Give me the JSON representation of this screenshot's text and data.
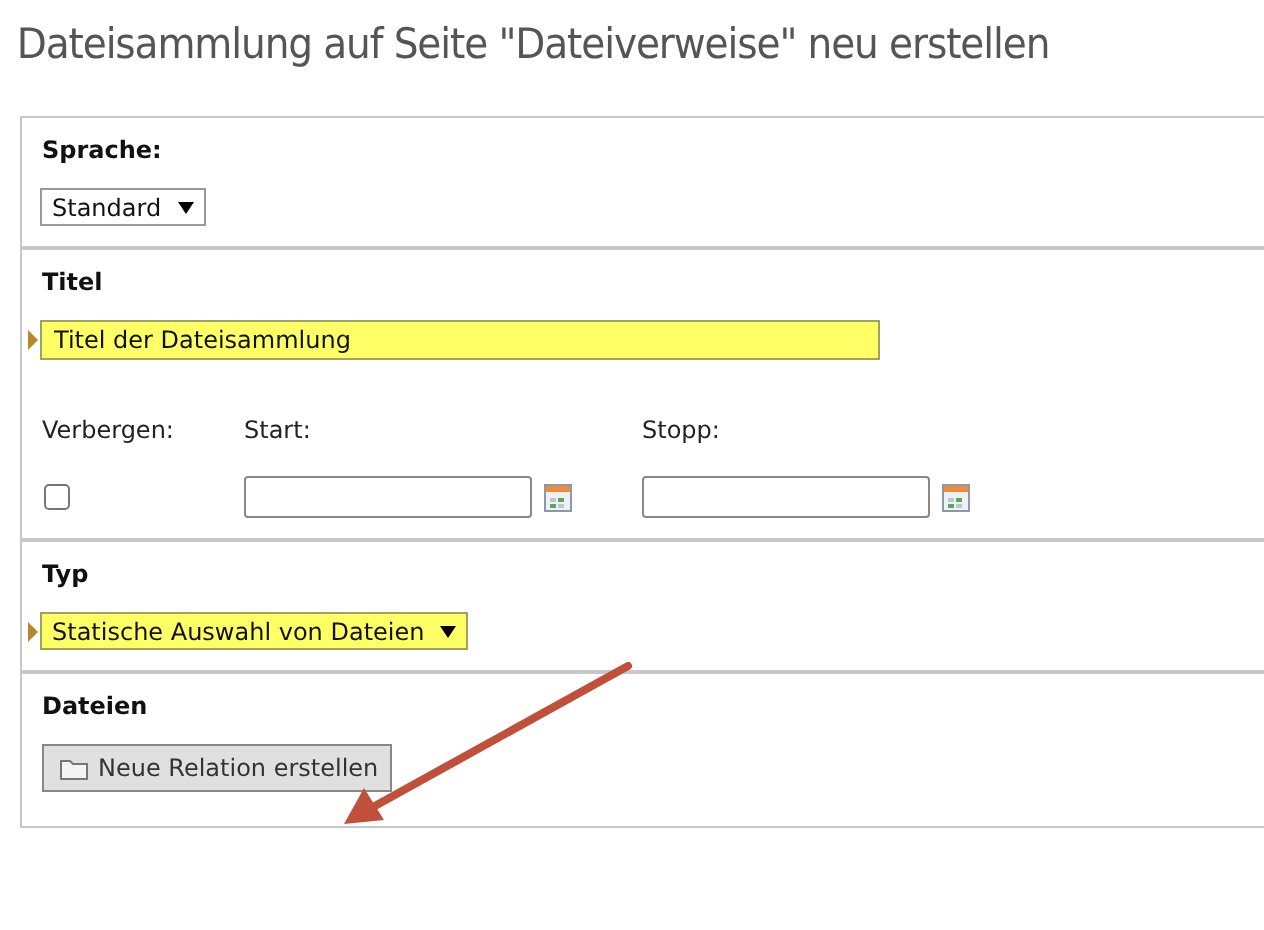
{
  "page_title": "Dateisammlung auf Seite \"Dateiverweise\" neu erstellen",
  "sections": [
    {
      "kind": "select",
      "label": "Sprache:",
      "field": {
        "value": "Standard",
        "highlighted": false
      }
    },
    {
      "kind": "text",
      "label": "Titel",
      "field": {
        "value": "Titel der Dateisammlung",
        "highlighted": true
      },
      "extras": {
        "hide_label": "Verbergen:",
        "hidden": false,
        "start_label": "Start:",
        "stop_label": "Stopp:"
      }
    },
    {
      "kind": "select",
      "label": "Typ",
      "field": {
        "value": "Statische Auswahl von Dateien",
        "highlighted": true
      }
    },
    {
      "kind": "button",
      "label": "Dateien",
      "button": "Neue Relation erstellen"
    }
  ],
  "annotation": {
    "kind": "arrow",
    "color": "#c0503a"
  }
}
